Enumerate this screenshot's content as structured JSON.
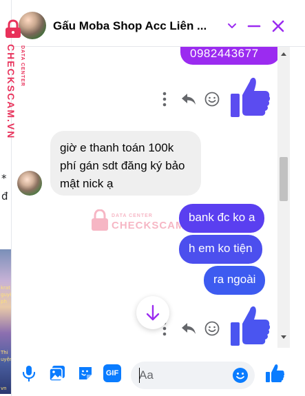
{
  "watermark": {
    "vertical_brand": "CHECKSCAM.VN",
    "vertical_sub": "DATA CENTER",
    "center_sub": "DATA CENTER",
    "center_brand": "CHECKSCAM.VN"
  },
  "background": {
    "glyph_star": "*",
    "glyph_d": "đ",
    "thumb_lines": [
      "krat",
      "guyên",
      "ph",
      "Thi",
      "uyện",
      "vn"
    ]
  },
  "header": {
    "title": "Gấu Moba Shop Acc Liên ...",
    "icons": [
      "avatar",
      "chevron-down-icon",
      "minimize-icon",
      "close-icon"
    ]
  },
  "messages": [
    {
      "direction": "outgoing",
      "text": "0982443677",
      "color": "#9b2bf0"
    },
    {
      "direction": "outgoing",
      "type": "large-like",
      "color": "#5b4cf0"
    },
    {
      "direction": "incoming",
      "text": "giờ e thanh toán 100k phí gán sdt đăng ký bảo mật nick ạ"
    },
    {
      "direction": "outgoing",
      "text": "bank đc ko a",
      "color": "#5a3ff0"
    },
    {
      "direction": "outgoing",
      "text": "h em ko tiện",
      "color": "#4c4fee"
    },
    {
      "direction": "outgoing",
      "text": "ra ngoài",
      "color": "#3d5bf0"
    },
    {
      "direction": "outgoing",
      "type": "large-like",
      "color": "#4a55f0"
    }
  ],
  "composer": {
    "placeholder": "Aa",
    "value": "",
    "gif_label": "GIF",
    "icons": [
      "microphone-icon",
      "image-icon",
      "sticker-icon",
      "gif-icon",
      "emoji-icon",
      "like-icon"
    ]
  },
  "colors": {
    "accent": "#9b2bf0",
    "brand_blue": "#0a7cff",
    "watermark": "#e8315a"
  }
}
